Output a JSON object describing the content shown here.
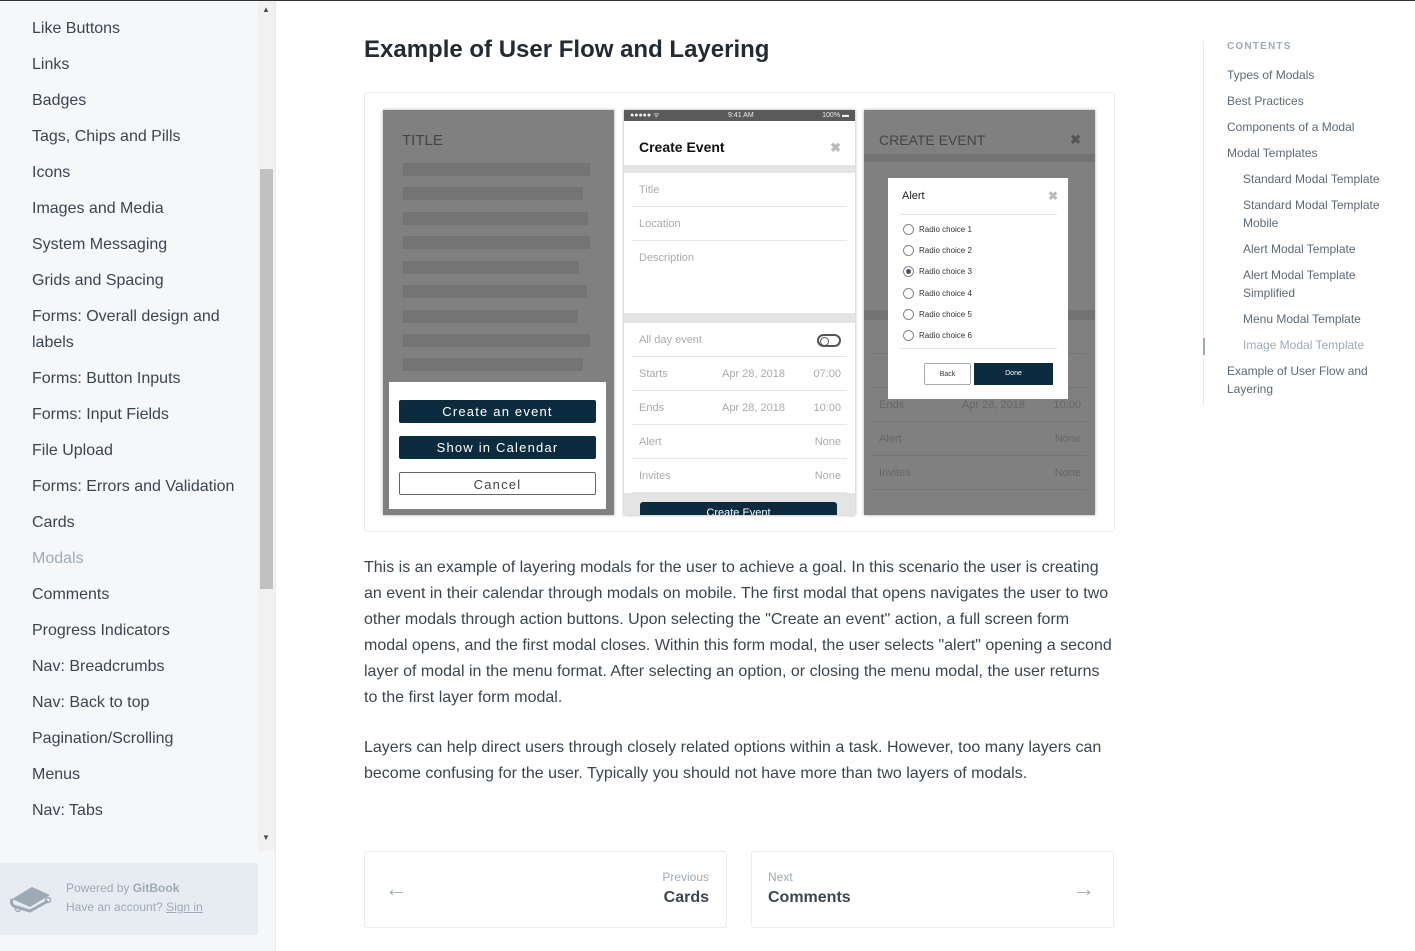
{
  "sidebar": {
    "items": [
      {
        "label": "Like Buttons"
      },
      {
        "label": "Links"
      },
      {
        "label": "Badges"
      },
      {
        "label": "Tags, Chips and Pills"
      },
      {
        "label": "Icons"
      },
      {
        "label": "Images and Media"
      },
      {
        "label": "System Messaging"
      },
      {
        "label": "Grids and Spacing"
      },
      {
        "label": "Forms: Overall design and labels"
      },
      {
        "label": "Forms: Button Inputs"
      },
      {
        "label": "Forms: Input Fields"
      },
      {
        "label": "File Upload"
      },
      {
        "label": "Forms: Errors and Validation"
      },
      {
        "label": "Cards"
      },
      {
        "label": "Modals",
        "active": true
      },
      {
        "label": "Comments"
      },
      {
        "label": "Progress Indicators"
      },
      {
        "label": "Nav: Breadcrumbs"
      },
      {
        "label": "Nav: Back to top"
      },
      {
        "label": "Pagination/Scrolling"
      },
      {
        "label": "Menus"
      },
      {
        "label": "Nav: Tabs"
      }
    ],
    "footer": {
      "powered": "Powered by ",
      "brand": "GitBook",
      "account": "Have an account? ",
      "signin": "Sign in"
    }
  },
  "main": {
    "title": "Example of User Flow and Layering",
    "figure": {
      "s1": {
        "title": "TITLE",
        "btn1": "Create an event",
        "btn2": "Show in Calendar",
        "btn3": "Cancel"
      },
      "s2": {
        "status_left": "●●●●● ᯤ",
        "time": "9:41 AM",
        "battery": "100% ▬",
        "header": "Create Event",
        "title": "Title",
        "location": "Location",
        "description": "Description",
        "allday": "All day event",
        "starts": "Starts",
        "starts_date": "Apr 28, 2018",
        "starts_time": "07:00",
        "ends": "Ends",
        "ends_date": "Apr 28, 2018",
        "ends_time": "10:00",
        "alert": "Alert",
        "alert_val": "None",
        "invites": "Invites",
        "invites_val": "None",
        "submit": "Create Event"
      },
      "s3": {
        "header": "CREATE EVENT",
        "ends": "Ends",
        "ends_date": "Apr 28, 2018",
        "ends_time": "10:00",
        "alert": "Alert",
        "alert_val": "None",
        "invites": "Invites",
        "invites_val": "None",
        "dialog": {
          "title": "Alert",
          "choices": [
            "Radio choice 1",
            "Radio choice 2",
            "Radio choice 3",
            "Radio choice 4",
            "Radio choice 5",
            "Radio choice 6"
          ],
          "selected": "Radio choice 3",
          "back": "Back",
          "done": "Done"
        }
      }
    },
    "para1": "This is an example of layering modals for the user to achieve a goal.  In this scenario the user is creating an event in their calendar through modals on mobile. The first modal that opens navigates the user to two other modals through action buttons. Upon selecting the \"Create an event\" action, a full screen form modal opens, and the first modal closes. Within this form modal, the user selects \"alert\" opening a second layer of modal in the menu format. After selecting an option, or closing the menu modal, the user returns to the first layer form modal.",
    "para2": "Layers can help direct users through closely related options within a task. However, too many layers can become confusing for the user. Typically you should not have more than two layers of modals.",
    "prev": {
      "label": "Previous",
      "title": "Cards"
    },
    "next": {
      "label": "Next",
      "title": "Comments"
    }
  },
  "toc": {
    "heading": "CONTENTS",
    "items": [
      {
        "label": "Types of Modals"
      },
      {
        "label": "Best Practices"
      },
      {
        "label": "Components of a Modal"
      },
      {
        "label": "Modal Templates"
      },
      {
        "label": "Standard Modal Template",
        "sub": true
      },
      {
        "label": "Standard Modal Template Mobile",
        "sub": true
      },
      {
        "label": "Alert Modal Template",
        "sub": true
      },
      {
        "label": "Alert Modal Template Simplified",
        "sub": true
      },
      {
        "label": "Menu Modal Template",
        "sub": true
      },
      {
        "label": "Image Modal Template",
        "sub": true,
        "current": true
      },
      {
        "label": "Example of User Flow and Layering"
      }
    ]
  }
}
